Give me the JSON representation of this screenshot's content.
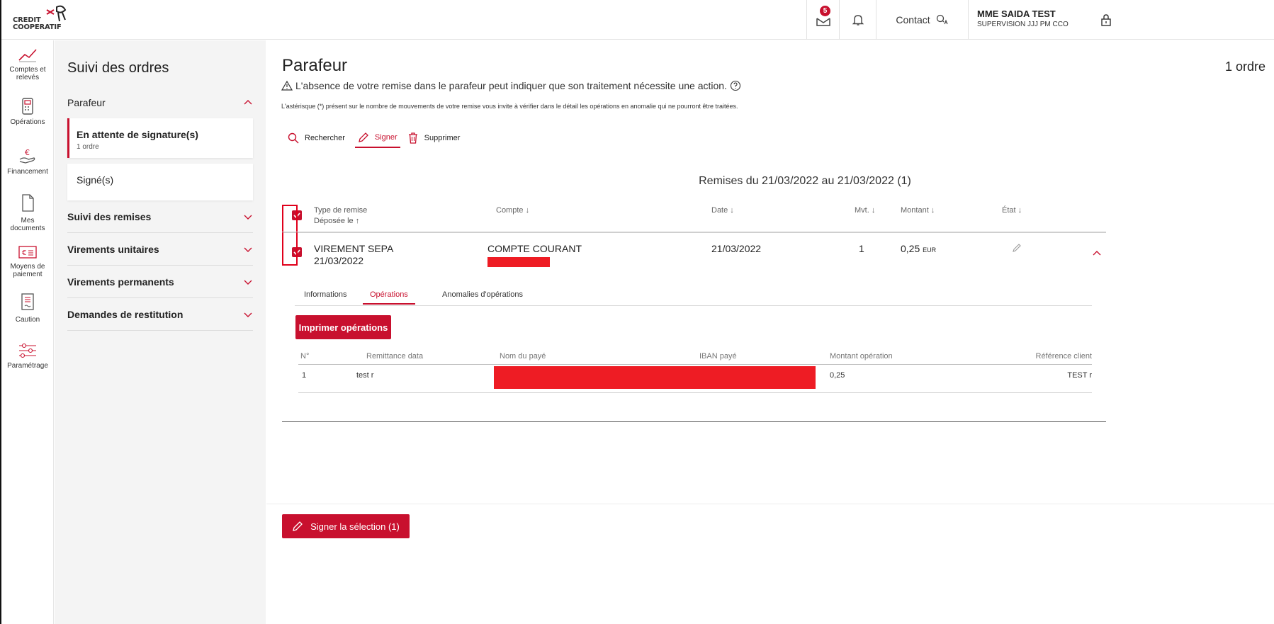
{
  "brand": {
    "line1": "CREDIT",
    "line2": "COOPERATIF",
    "accent": "#c8102e"
  },
  "header": {
    "mail_badge": "5",
    "contact_label": "Contact",
    "user_name": "MME SAIDA TEST",
    "user_sub": "SUPERVISION JJJ PM CCO"
  },
  "rail": [
    {
      "icon": "chart-line-icon",
      "label1": "Comptes et",
      "label2": "relevés"
    },
    {
      "icon": "calculator-icon",
      "label1": "Opérations",
      "label2": ""
    },
    {
      "icon": "euro-hand-icon",
      "label1": "Financement",
      "label2": ""
    },
    {
      "icon": "documents-icon",
      "label1": "Mes",
      "label2": "documents"
    },
    {
      "icon": "payment-card-icon",
      "label1": "Moyens de",
      "label2": "paiement"
    },
    {
      "icon": "caution-doc-icon",
      "label1": "Caution",
      "label2": ""
    },
    {
      "icon": "sliders-icon",
      "label1": "Paramétrage",
      "label2": ""
    }
  ],
  "side": {
    "title": "Suivi des ordres",
    "parafeur": "Parafeur",
    "pending_title": "En attente de signature(s)",
    "pending_sub": "1 ordre",
    "signed": "Signé(s)",
    "sections": [
      "Suivi des remises",
      "Virements unitaires",
      "Virements permanents",
      "Demandes de restitution"
    ]
  },
  "main": {
    "title": "Parafeur",
    "count": "1 ordre",
    "warning": "L'absence de votre remise dans le parafeur peut indiquer que son traitement nécessite une action.",
    "note": "L'astérisque (*) présent sur le nombre de mouvements de votre remise vous invite à vérifier dans le détail les opérations en anomalie qui ne pourront être traitées.",
    "toolbar": {
      "search": "Rechercher",
      "sign": "Signer",
      "delete": "Supprimer"
    },
    "remises_title": "Remises du 21/03/2022 au 21/03/2022 (1)",
    "columns": {
      "type": "Type de remise",
      "deposit": "Déposée le ↑",
      "account": "Compte ↓",
      "date": "Date ↓",
      "mvt": "Mvt. ↓",
      "amount": "Montant ↓",
      "state": "État ↓"
    },
    "row": {
      "type": "VIREMENT SEPA",
      "deposit": "21/03/2022",
      "account": "COMPTE COURANT",
      "date": "21/03/2022",
      "mvt": "1",
      "amount": "0,25",
      "currency": "EUR"
    },
    "subtabs": [
      "Informations",
      "Opérations",
      "Anomalies d'opérations"
    ],
    "print_button": "Imprimer opérations",
    "op_columns": [
      "N°",
      "Remittance data",
      "Nom du payé",
      "IBAN payé",
      "Montant opération",
      "Référence client"
    ],
    "op_row": {
      "n": "1",
      "remittance": "test r",
      "amount": "0,25",
      "reference": "TEST r"
    },
    "sign_selection": "Signer la sélection (1)"
  }
}
